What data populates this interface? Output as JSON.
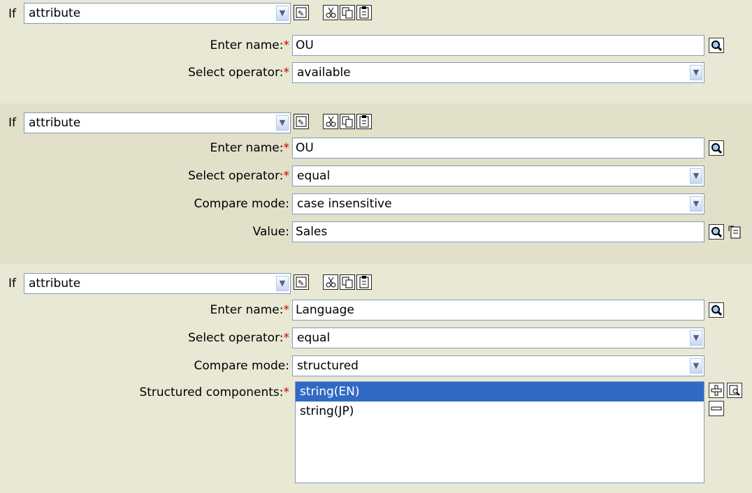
{
  "conditions": [
    {
      "if_label": "If",
      "type": "attribute",
      "fields": {
        "name_label": "Enter name:",
        "name_value": "OU",
        "operator_label": "Select operator:",
        "operator_value": "available"
      }
    },
    {
      "if_label": "If",
      "type": "attribute",
      "fields": {
        "name_label": "Enter name:",
        "name_value": "OU",
        "operator_label": "Select operator:",
        "operator_value": "equal",
        "compare_label": "Compare mode:",
        "compare_value": "case insensitive",
        "value_label": "Value:",
        "value_value": "Sales"
      }
    },
    {
      "if_label": "If",
      "type": "attribute",
      "fields": {
        "name_label": "Enter name:",
        "name_value": "Language",
        "operator_label": "Select operator:",
        "operator_value": "equal",
        "compare_label": "Compare mode:",
        "compare_value": "structured",
        "components_label": "Structured components:",
        "components": [
          "string(EN)",
          "string(JP)"
        ]
      }
    }
  ],
  "required_marker": "*",
  "colors": {
    "panel_light": "#e9e8d4",
    "panel_dark": "#e2e0c9",
    "selection": "#316ac5",
    "required": "#cc0000",
    "input_border": "#7f9db9"
  },
  "icons": {
    "toolbar": [
      "edit-icon",
      "cut-icon",
      "copy-icon",
      "paste-icon"
    ],
    "browse": "search-icon",
    "edit_value": "value-editor-icon",
    "add": "plus-icon",
    "edit_component": "edit-component-icon",
    "remove": "minus-icon"
  }
}
